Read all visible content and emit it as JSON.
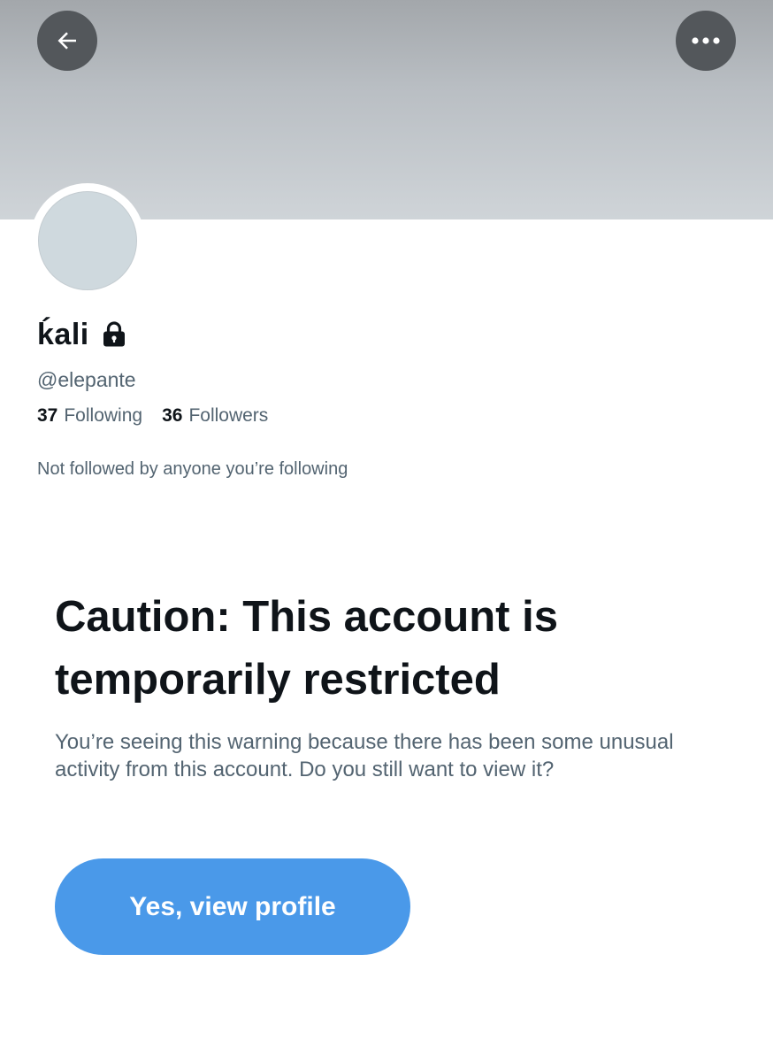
{
  "header": {
    "back_icon": "arrow-left-icon",
    "more_icon": "more-horizontal-icon"
  },
  "profile": {
    "display_name": "ḱali",
    "lock_icon": "lock-icon",
    "handle": "@elepante",
    "following_count": "37",
    "following_label": "Following",
    "followers_count": "36",
    "followers_label": "Followers",
    "followed_by_note": "Not followed by anyone you’re following"
  },
  "warning": {
    "title": "Caution: This account is temporarily restricted",
    "body": "You’re seeing this warning because there has been some unusual activity from this account. Do you still want to view it?",
    "button_label": "Yes, view profile"
  },
  "colors": {
    "accent": "#4a99e9",
    "text_primary": "#0f1419",
    "text_secondary": "#536471",
    "icon_button_bg": "#53575b",
    "avatar_placeholder": "#cfd9de"
  }
}
